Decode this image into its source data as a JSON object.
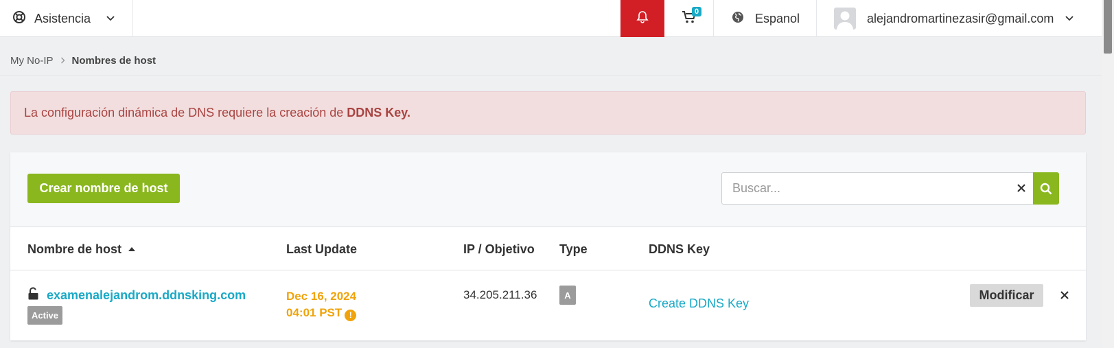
{
  "topbar": {
    "support_label": "Asistencia",
    "cart_count": "0",
    "language_label": "Espanol",
    "user_email": "alejandromartinezasir@gmail.com"
  },
  "breadcrumb": {
    "home": "My No-IP",
    "current": "Nombres de host"
  },
  "alert": {
    "text": "La configuración dinámica de DNS requiere la creación de",
    "strong": "DDNS Key."
  },
  "toolbar": {
    "create_label": "Crear nombre de host",
    "search_placeholder": "Buscar...",
    "search_value": ""
  },
  "table": {
    "columns": [
      "Nombre de host",
      "Last Update",
      "IP / Objetivo",
      "Type",
      "DDNS Key"
    ],
    "rows": [
      {
        "hostname": "examenalejandrom.ddnsking.com",
        "status": "Active",
        "date": "Dec 16, 2024",
        "time": "04:01 PST",
        "ip": "34.205.211.36",
        "type": "A",
        "ddns_action": "Create DDNS Key",
        "modify_label": "Modificar"
      }
    ]
  },
  "colors": {
    "brand_green": "#8ab71e",
    "alert_red": "#d21f26",
    "link_blue": "#19a9c6",
    "warning_orange": "#f0a30a"
  }
}
